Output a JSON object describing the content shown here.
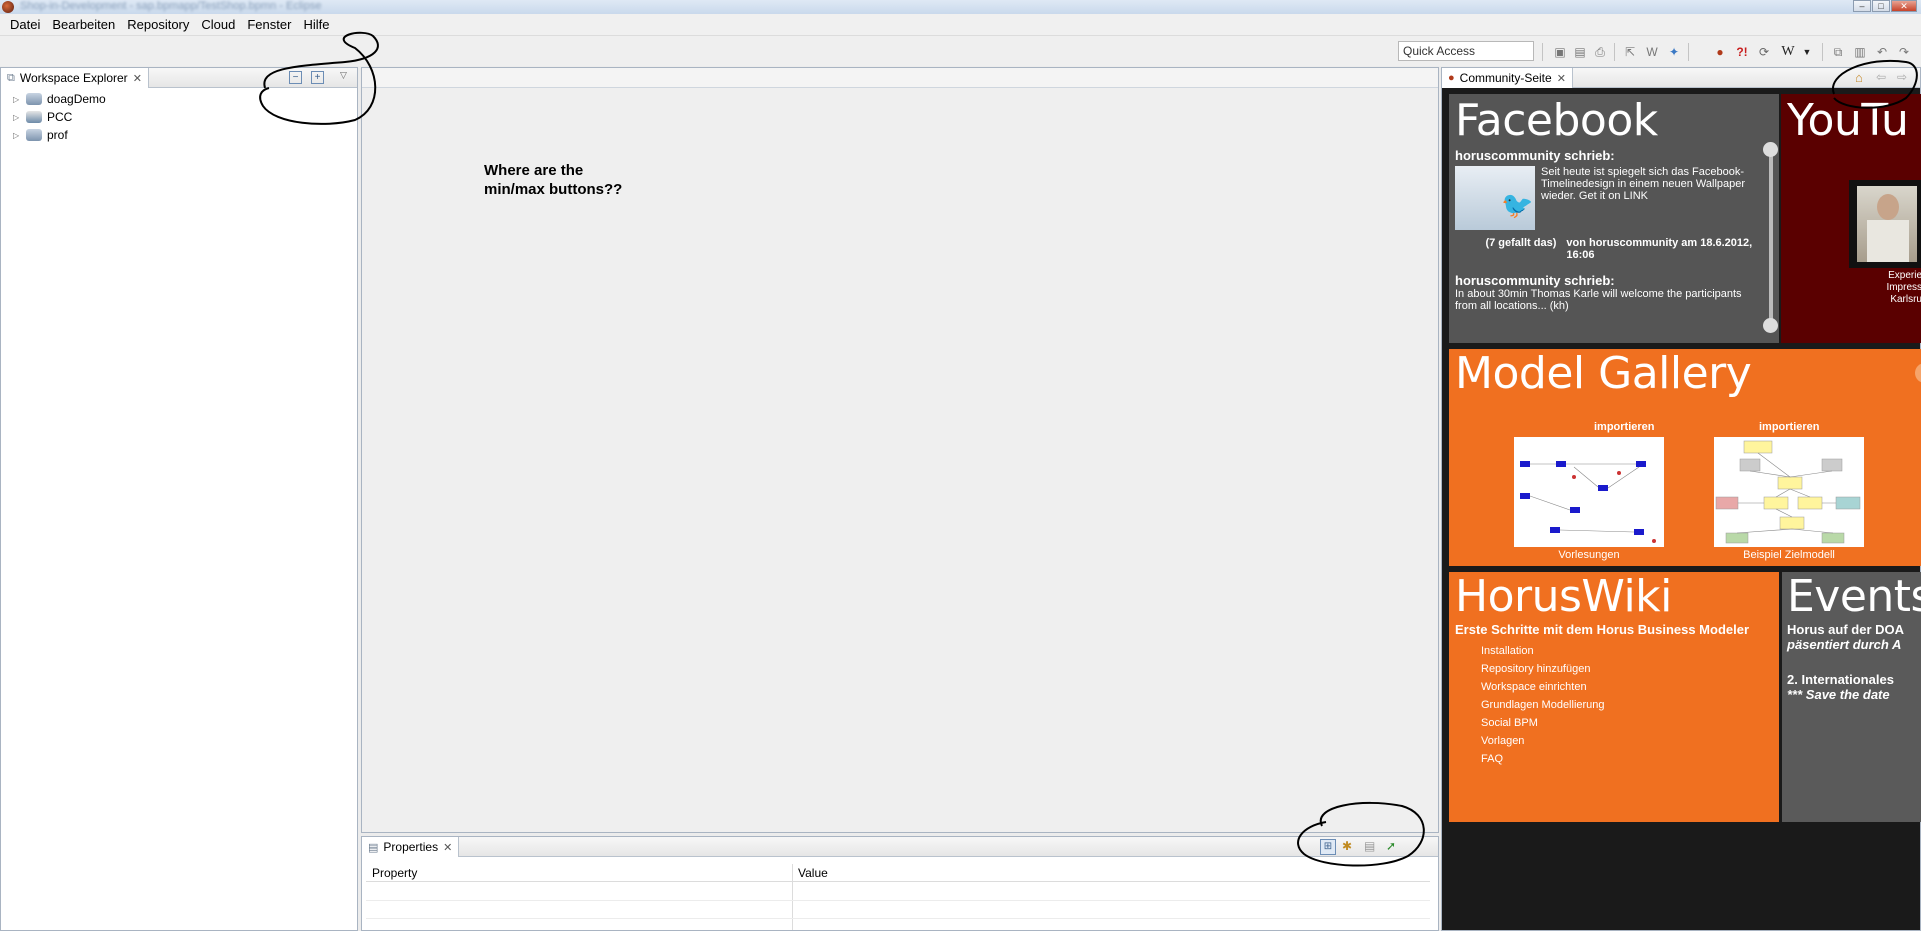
{
  "window": {
    "title": "Shop-in-Development - sap.bpmapp/TestShop.bpmn - Eclipse"
  },
  "menubar": {
    "items": [
      "Datei",
      "Bearbeiten",
      "Repository",
      "Cloud",
      "Fenster",
      "Hilfe"
    ]
  },
  "toolbar": {
    "quick_access": "Quick Access"
  },
  "explorer": {
    "tab_label": "Workspace Explorer",
    "projects": [
      "doagDemo",
      "PCC",
      "prof"
    ]
  },
  "editor": {
    "note": "Where are the min/max buttons??"
  },
  "properties": {
    "tab_label": "Properties",
    "col_property": "Property",
    "col_value": "Value"
  },
  "community": {
    "tab_label": "Community-Seite",
    "facebook": {
      "title": "Facebook",
      "post1_author": "horuscommunity schrieb:",
      "post1_text": "Seit heute ist spiegelt sich das Facebook-Timelinedesign in einem neuen Wallpaper wieder. Get it on LINK",
      "post1_likes": "(7 gefallt das)",
      "post1_meta": "von horuscommunity am 18.6.2012, 16:06",
      "post2_author": "horuscommunity schrieb:",
      "post2_text": "In about 30min Thomas Karle will welcome the participants from all locations... (kh)"
    },
    "youtube": {
      "title": "YouTu",
      "caption_line1": "Experie",
      "caption_line2": "Impress",
      "caption_line3": "Karlsru"
    },
    "gallery": {
      "title": "Model Gallery",
      "item1_action": "importieren",
      "item1_caption": "Vorlesungen",
      "item2_action": "importieren",
      "item2_caption": "Beispiel Zielmodell"
    },
    "wiki": {
      "title": "HorusWiki",
      "subtitle": "Erste Schritte mit dem Horus Business Modeler",
      "links": [
        "Installation",
        "Repository hinzufügen",
        "Workspace einrichten",
        "Grundlagen Modellierung",
        "Social BPM",
        "Vorlagen",
        "FAQ"
      ]
    },
    "events": {
      "title": "Events",
      "line1": "Horus auf der DOA",
      "line2": "päsentiert durch A",
      "line3": "2. Internationales",
      "line4": "*** Save the date"
    }
  },
  "colors": {
    "facebook_bg": "#555555",
    "youtube_bg": "#5a0000",
    "gallery_bg": "#f07020",
    "wiki_bg": "#f07020",
    "events_bg": "#5a5a5a"
  }
}
